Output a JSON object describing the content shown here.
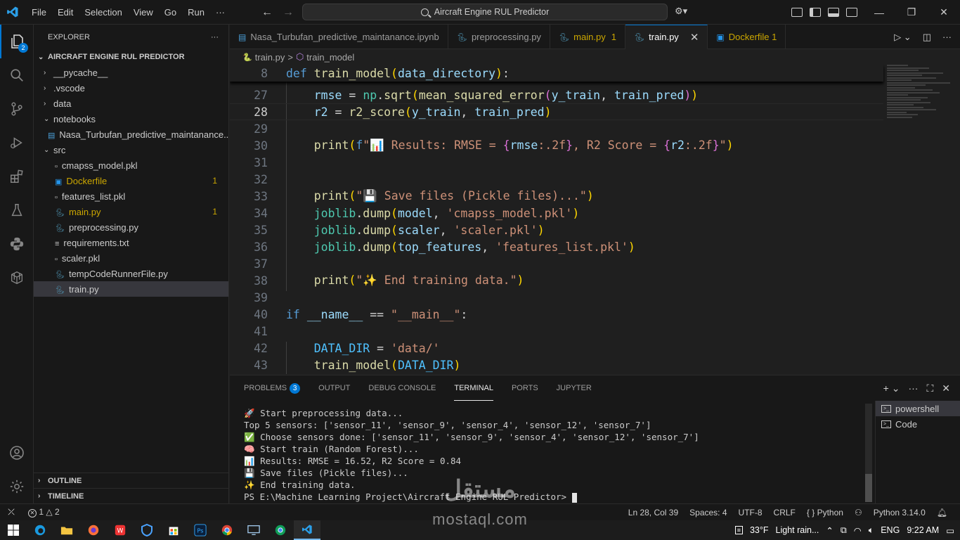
{
  "titlebar": {
    "menu": [
      "File",
      "Edit",
      "Selection",
      "View",
      "Go",
      "Run",
      "···"
    ],
    "search_text": "Aircraft Engine RUL Predictor"
  },
  "activity": {
    "explorer_badge": "2"
  },
  "sidebar": {
    "title": "EXPLORER",
    "more": "···",
    "project": "AIRCRAFT ENGINE RUL PREDICTOR",
    "items": [
      {
        "label": "__pycache__",
        "type": "folder",
        "indent": 0,
        "open": false
      },
      {
        "label": ".vscode",
        "type": "folder",
        "indent": 0,
        "open": false
      },
      {
        "label": "data",
        "type": "folder",
        "indent": 0,
        "open": false
      },
      {
        "label": "notebooks",
        "type": "folder",
        "indent": 0,
        "open": true
      },
      {
        "label": "Nasa_Turbufan_predictive_maintanance....",
        "type": "notebook",
        "indent": 1
      },
      {
        "label": "src",
        "type": "folder",
        "indent": 0,
        "open": true
      },
      {
        "label": "cmapss_model.pkl",
        "type": "file",
        "indent": 0
      },
      {
        "label": "Dockerfile",
        "type": "docker",
        "indent": 0,
        "count": "1",
        "warn": true
      },
      {
        "label": "features_list.pkl",
        "type": "file",
        "indent": 0
      },
      {
        "label": "main.py",
        "type": "python",
        "indent": 0,
        "count": "1",
        "warn": true
      },
      {
        "label": "preprocessing.py",
        "type": "python",
        "indent": 0
      },
      {
        "label": "requirements.txt",
        "type": "text",
        "indent": 0
      },
      {
        "label": "scaler.pkl",
        "type": "file",
        "indent": 0
      },
      {
        "label": "tempCodeRunnerFile.py",
        "type": "python",
        "indent": 0
      },
      {
        "label": "train.py",
        "type": "python",
        "indent": 0,
        "selected": true
      }
    ],
    "outline": "OUTLINE",
    "timeline": "TIMELINE"
  },
  "tabs": [
    {
      "label": "Nasa_Turbufan_predictive_maintanance.ipynb",
      "icon": "notebook"
    },
    {
      "label": "preprocessing.py",
      "icon": "python"
    },
    {
      "label": "main.py",
      "icon": "python",
      "count": "1",
      "warn": true
    },
    {
      "label": "train.py",
      "icon": "python",
      "active": true
    },
    {
      "label": "Dockerfile 1",
      "icon": "docker",
      "warn": true
    }
  ],
  "breadcrumb": {
    "file": "train.py",
    "sep": ">",
    "symbol": "train_model"
  },
  "editor": {
    "sticky_line": {
      "n": "8",
      "code": "def train_model(data_directory):"
    },
    "lines": [
      {
        "n": "27",
        "code": "    rmse = np.sqrt(mean_squared_error(y_train, train_pred))"
      },
      {
        "n": "28",
        "code": "    r2 = r2_score(y_train, train_pred)",
        "current": true
      },
      {
        "n": "29",
        "code": ""
      },
      {
        "n": "30",
        "code": "    print(f\"📊 Results: RMSE = {rmse:.2f}, R2 Score = {r2:.2f}\")"
      },
      {
        "n": "31",
        "code": ""
      },
      {
        "n": "32",
        "code": ""
      },
      {
        "n": "33",
        "code": "    print(\"💾 Save files (Pickle files)...\")"
      },
      {
        "n": "34",
        "code": "    joblib.dump(model, 'cmapss_model.pkl')"
      },
      {
        "n": "35",
        "code": "    joblib.dump(scaler, 'scaler.pkl')"
      },
      {
        "n": "36",
        "code": "    joblib.dump(top_features, 'features_list.pkl')"
      },
      {
        "n": "37",
        "code": ""
      },
      {
        "n": "38",
        "code": "    print(\"✨ End training data.\")"
      },
      {
        "n": "39",
        "code": ""
      },
      {
        "n": "40",
        "code": "if __name__ == \"__main__\":"
      },
      {
        "n": "41",
        "code": ""
      },
      {
        "n": "42",
        "code": "    DATA_DIR = 'data/'"
      },
      {
        "n": "43",
        "code": "    train_model(DATA_DIR)"
      }
    ]
  },
  "panel": {
    "tabs": [
      {
        "label": "PROBLEMS",
        "badge": "3"
      },
      {
        "label": "OUTPUT"
      },
      {
        "label": "DEBUG CONSOLE"
      },
      {
        "label": "TERMINAL",
        "active": true
      },
      {
        "label": "PORTS"
      },
      {
        "label": "JUPYTER"
      }
    ],
    "terminal_lines": [
      "🚀 Start preprocessing data...",
      "Top 5 sensors: ['sensor_11', 'sensor_9', 'sensor_4', 'sensor_12', 'sensor_7']",
      "✅ Choose sensors done: ['sensor_11', 'sensor_9', 'sensor_4', 'sensor_12', 'sensor_7']",
      "🧠 Start train (Random Forest)...",
      "📊 Results: RMSE = 16.52, R2 Score = 0.84",
      "💾 Save files (Pickle files)...",
      "✨ End training data."
    ],
    "prompt": "PS E:\\Machine Learning Project\\Aircraft Engine RUL Predictor> ",
    "terminals": [
      "powershell",
      "Code"
    ]
  },
  "statusbar": {
    "errors": "1",
    "warnings": "2",
    "position": "Ln 28, Col 39",
    "spaces": "Spaces: 4",
    "encoding": "UTF-8",
    "eol": "CRLF",
    "language": "Python",
    "interpreter": "Python 3.14.0"
  },
  "taskbar": {
    "temperature": "33°F",
    "weather": "Light rain...",
    "lang": "ENG",
    "time": "9:22 AM"
  },
  "watermark": {
    "arabic": "مستقل",
    "latin": "mostaql.com"
  }
}
